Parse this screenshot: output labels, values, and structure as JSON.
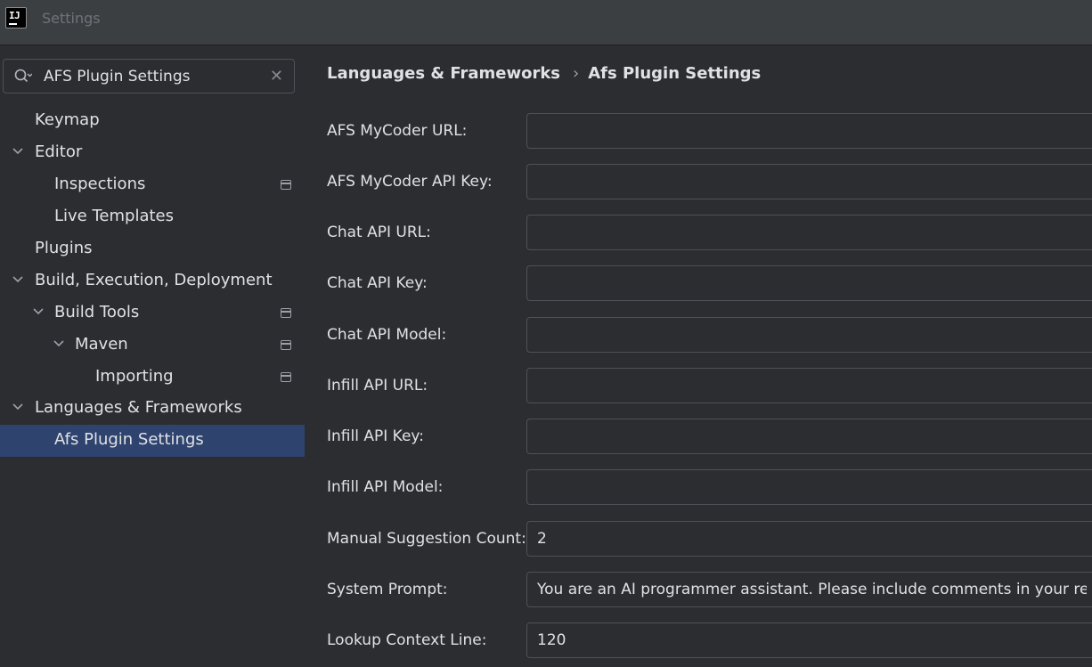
{
  "window": {
    "title": "Settings",
    "logo_text": "IJ"
  },
  "search": {
    "value": "AFS Plugin Settings"
  },
  "tree": {
    "keymap": "Keymap",
    "editor": "Editor",
    "inspections": "Inspections",
    "live_templates": "Live Templates",
    "plugins": "Plugins",
    "build": "Build, Execution, Deployment",
    "build_tools": "Build Tools",
    "maven": "Maven",
    "importing": "Importing",
    "languages": "Languages & Frameworks",
    "afs_plugin": "Afs Plugin Settings"
  },
  "breadcrumb": {
    "parent": "Languages & Frameworks",
    "separator": "›",
    "current": "Afs Plugin Settings"
  },
  "form": {
    "mycoder_url": {
      "label": "AFS MyCoder URL:",
      "value": ""
    },
    "mycoder_key": {
      "label": "AFS MyCoder API Key:",
      "value": ""
    },
    "chat_url": {
      "label": "Chat API URL:",
      "value": ""
    },
    "chat_key": {
      "label": "Chat API Key:",
      "value": ""
    },
    "chat_model": {
      "label": "Chat API Model:",
      "value": ""
    },
    "infill_url": {
      "label": "Infill API URL:",
      "value": ""
    },
    "infill_key": {
      "label": "Infill API Key:",
      "value": ""
    },
    "infill_model": {
      "label": "Infill API Model:",
      "value": ""
    },
    "suggestion_count": {
      "label": "Manual Suggestion Count:",
      "value": "2"
    },
    "system_prompt": {
      "label": "System Prompt:",
      "value": "You are an AI programmer assistant. Please include comments in your respons"
    },
    "lookup_context": {
      "label": "Lookup Context Line:",
      "value": "120"
    }
  },
  "colors": {
    "selection": "#2e436e",
    "background": "#2b2d30",
    "titlebar": "#3c3f41",
    "border": "#4e5157"
  }
}
